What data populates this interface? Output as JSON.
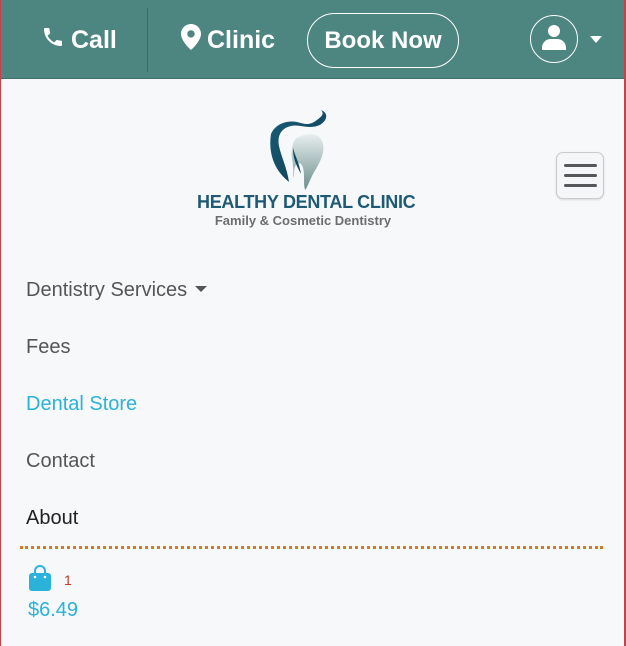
{
  "topbar": {
    "call_label": "Call",
    "clinic_label": "Clinic",
    "book_label": "Book Now",
    "bg_color": "#4d8680",
    "icons": {
      "call": "phone-icon",
      "clinic": "map-pin-icon",
      "user": "user-icon",
      "caret": "caret-down-icon"
    }
  },
  "logo": {
    "title": "HEALTHY DENTAL CLINIC",
    "subtitle": "Family & Cosmetic Dentistry"
  },
  "menu_icon": "hamburger-icon",
  "nav": {
    "items": [
      {
        "label": "Dentistry Services",
        "has_dropdown": true
      },
      {
        "label": "Fees"
      },
      {
        "label": "Dental Store",
        "active": true
      },
      {
        "label": "Contact"
      },
      {
        "label": "About"
      }
    ]
  },
  "cart": {
    "icon": "shopping-bag-icon",
    "count": "1",
    "total": "$6.49"
  },
  "colors": {
    "accent": "#2bb2d8",
    "divider": "#d37a26",
    "badge": "#c0392b"
  }
}
